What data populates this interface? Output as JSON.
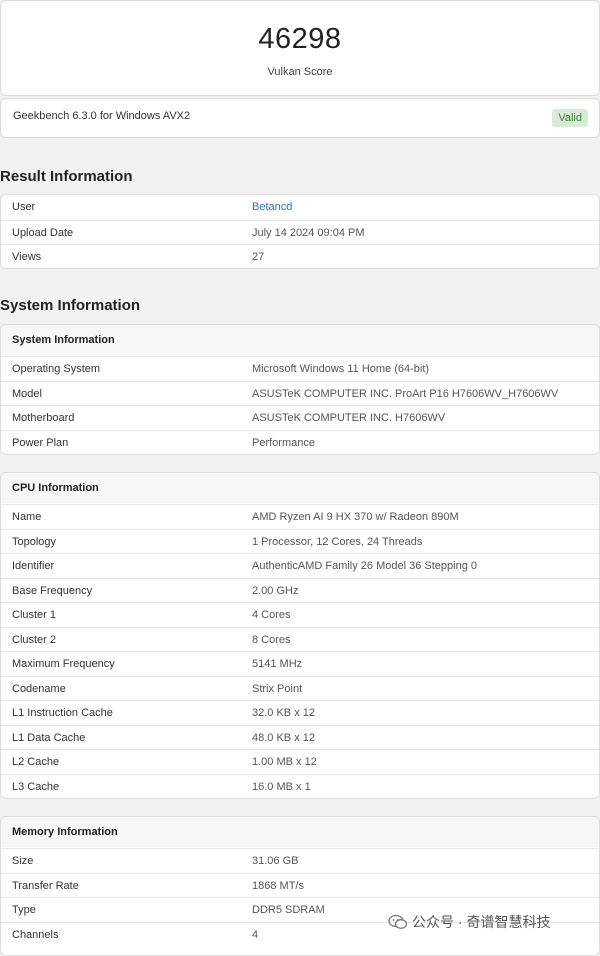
{
  "score": {
    "value": "46298",
    "label": "Vulkan Score"
  },
  "version": {
    "text": "Geekbench 6.3.0 for Windows AVX2",
    "badge": "Valid"
  },
  "result": {
    "title": "Result Information",
    "rows": [
      {
        "key": "User",
        "value": "Betancd"
      },
      {
        "key": "Upload Date",
        "value": "July 14 2024 09:04 PM"
      },
      {
        "key": "Views",
        "value": "27"
      }
    ]
  },
  "system_title": "System Information",
  "system": {
    "header": "System Information",
    "rows": [
      {
        "key": "Operating System",
        "value": "Microsoft Windows 11 Home (64-bit)"
      },
      {
        "key": "Model",
        "value": "ASUSTeK COMPUTER INC. ProArt P16 H7606WV_H7606WV"
      },
      {
        "key": "Motherboard",
        "value": "ASUSTeK COMPUTER INC. H7606WV"
      },
      {
        "key": "Power Plan",
        "value": "Performance"
      }
    ]
  },
  "cpu": {
    "header": "CPU Information",
    "rows": [
      {
        "key": "Name",
        "value": "AMD Ryzen AI 9 HX 370 w/ Radeon 890M"
      },
      {
        "key": "Topology",
        "value": "1 Processor, 12 Cores, 24 Threads"
      },
      {
        "key": "Identifier",
        "value": "AuthenticAMD Family 26 Model 36 Stepping 0"
      },
      {
        "key": "Base Frequency",
        "value": "2.00 GHz"
      },
      {
        "key": "Cluster 1",
        "value": "4 Cores"
      },
      {
        "key": "Cluster 2",
        "value": "8 Cores"
      },
      {
        "key": "Maximum Frequency",
        "value": "5141 MHz"
      },
      {
        "key": "Codename",
        "value": "Strix Point"
      },
      {
        "key": "L1 Instruction Cache",
        "value": "32.0 KB x 12"
      },
      {
        "key": "L1 Data Cache",
        "value": "48.0 KB x 12"
      },
      {
        "key": "L2 Cache",
        "value": "1.00 MB x 12"
      },
      {
        "key": "L3 Cache",
        "value": "16.0 MB x 1"
      }
    ]
  },
  "memory": {
    "header": "Memory Information",
    "rows": [
      {
        "key": "Size",
        "value": "31.06 GB"
      },
      {
        "key": "Transfer Rate",
        "value": "1868 MT/s"
      },
      {
        "key": "Type",
        "value": "DDR5 SDRAM"
      },
      {
        "key": "Channels",
        "value": "4"
      }
    ]
  },
  "watermark": {
    "text": "公众号 · 奇谱智慧科技",
    "icon": "wechat-icon"
  }
}
